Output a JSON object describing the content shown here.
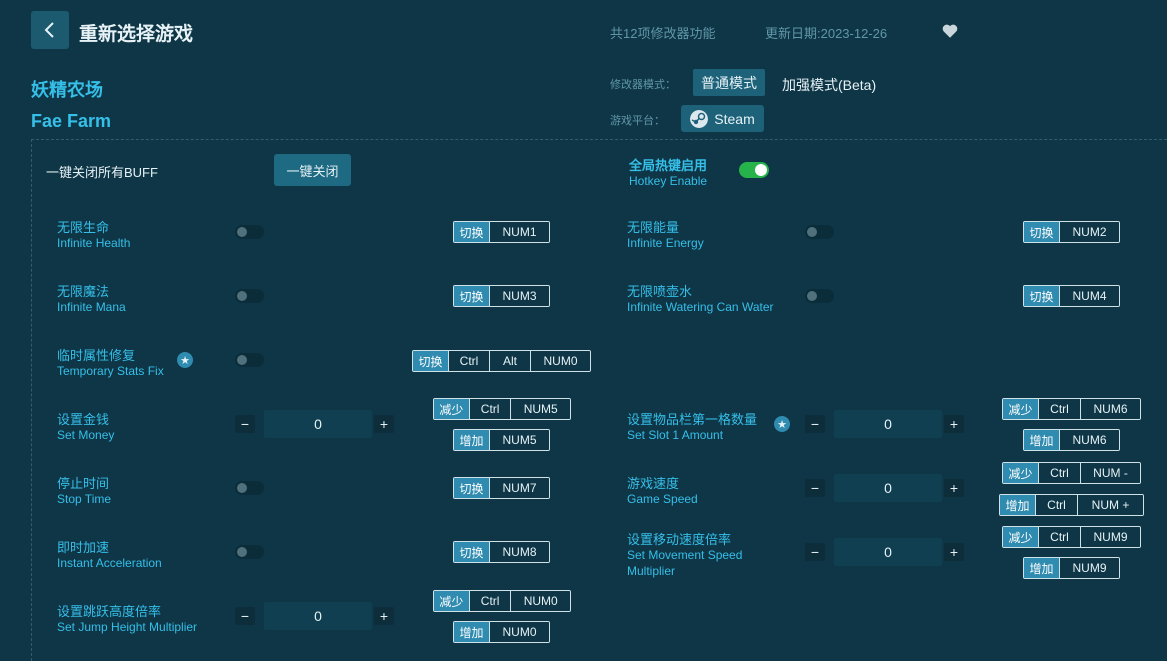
{
  "header": {
    "title": "重新选择游戏",
    "func_count": "共12项修改器功能",
    "update_date": "更新日期:2023-12-26"
  },
  "game": {
    "name_cn": "妖精农场",
    "name_en": "Fae Farm"
  },
  "mode": {
    "label": "修改器模式：",
    "normal": "普通模式",
    "enhanced": "加强模式(Beta)"
  },
  "platform": {
    "label": "游戏平台：",
    "name": "Steam"
  },
  "global": {
    "buff_label": "一键关闭所有BUFF",
    "onekey_btn": "一键关闭",
    "hotkey_cn": "全局热键启用",
    "hotkey_en": "Hotkey Enable"
  },
  "options": [
    {
      "cn": "无限生命",
      "en": "Infinite Health",
      "action": "切换",
      "keys": [
        "NUM1"
      ]
    },
    {
      "cn": "无限能量",
      "en": "Infinite Energy",
      "action": "切换",
      "keys": [
        "NUM2"
      ]
    },
    {
      "cn": "无限魔法",
      "en": "Infinite Mana",
      "action": "切换",
      "keys": [
        "NUM3"
      ]
    },
    {
      "cn": "无限喷壶水",
      "en": "Infinite Watering Can Water",
      "action": "切换",
      "keys": [
        "NUM4"
      ]
    },
    {
      "cn": "临时属性修复",
      "en": "Temporary Stats Fix",
      "action": "切换",
      "keys": [
        "Ctrl",
        "Alt",
        "NUM0"
      ]
    },
    {
      "cn": "设置金钱",
      "en": "Set Money",
      "value": "0",
      "dec": {
        "action": "减少",
        "keys": [
          "Ctrl",
          "NUM5"
        ]
      },
      "inc": {
        "action": "增加",
        "keys": [
          "NUM5"
        ]
      }
    },
    {
      "cn": "设置物品栏第一格数量",
      "en": "Set Slot 1 Amount",
      "value": "0",
      "dec": {
        "action": "减少",
        "keys": [
          "Ctrl",
          "NUM6"
        ]
      },
      "inc": {
        "action": "增加",
        "keys": [
          "NUM6"
        ]
      }
    },
    {
      "cn": "停止时间",
      "en": "Stop Time",
      "action": "切换",
      "keys": [
        "NUM7"
      ]
    },
    {
      "cn": "游戏速度",
      "en": "Game Speed",
      "value": "0",
      "dec": {
        "action": "减少",
        "keys": [
          "Ctrl",
          "NUM -"
        ]
      },
      "inc": {
        "action": "增加",
        "keys": [
          "Ctrl",
          "NUM +"
        ]
      }
    },
    {
      "cn": "即时加速",
      "en": "Instant Acceleration",
      "action": "切换",
      "keys": [
        "NUM8"
      ]
    },
    {
      "cn": "设置移动速度倍率",
      "en": "Set Movement Speed",
      "en2": "Multiplier",
      "value": "0",
      "dec": {
        "action": "减少",
        "keys": [
          "Ctrl",
          "NUM9"
        ]
      },
      "inc": {
        "action": "增加",
        "keys": [
          "NUM9"
        ]
      }
    },
    {
      "cn": "设置跳跃高度倍率",
      "en": "Set Jump Height Multiplier",
      "value": "0",
      "dec": {
        "action": "减少",
        "keys": [
          "Ctrl",
          "NUM0"
        ]
      },
      "inc": {
        "action": "增加",
        "keys": [
          "NUM0"
        ]
      }
    }
  ],
  "icons": {
    "minus": "−",
    "plus": "+",
    "star": "★"
  },
  "colors": {
    "accent": "#35bfe9",
    "background": "#0f3646",
    "toggle_on": "#25b34a",
    "key_action": "#2f8bb0"
  }
}
